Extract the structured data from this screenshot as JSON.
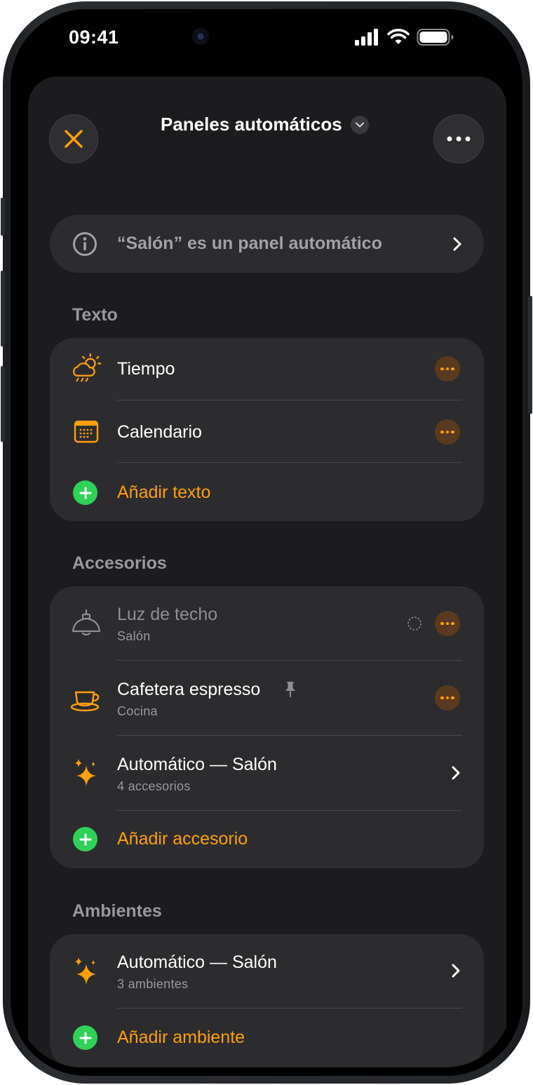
{
  "status_bar": {
    "time": "09:41"
  },
  "header": {
    "title": "Paneles automáticos"
  },
  "info_banner": {
    "label": "“Salón” es un panel automático"
  },
  "sections": {
    "text": {
      "header": "Texto",
      "items": [
        {
          "label": "Tiempo",
          "icon": "weather-icon"
        },
        {
          "label": "Calendario",
          "icon": "calendar-icon"
        }
      ],
      "add_label": "Añadir texto"
    },
    "accessories": {
      "header": "Accesorios",
      "items": [
        {
          "label": "Luz de techo",
          "sublabel": "Salón",
          "icon": "ceiling-light-icon"
        },
        {
          "label": "Cafetera espresso",
          "sublabel": "Cocina",
          "icon": "coffee-cup-icon",
          "pinned": true
        },
        {
          "label": "Automático — Salón",
          "sublabel": "4 accesorios",
          "icon": "sparkles-icon"
        }
      ],
      "add_label": "Añadir accesorio"
    },
    "scenes": {
      "header": "Ambientes",
      "items": [
        {
          "label": "Automático — Salón",
          "sublabel": "3 ambientes",
          "icon": "sparkles-icon"
        }
      ],
      "add_label": "Añadir ambiente"
    }
  },
  "colors": {
    "accent": "#ff9f0a",
    "add_green": "#30d158",
    "sheet_bg": "#1c1c1e",
    "card_bg": "#2c2c2e"
  }
}
